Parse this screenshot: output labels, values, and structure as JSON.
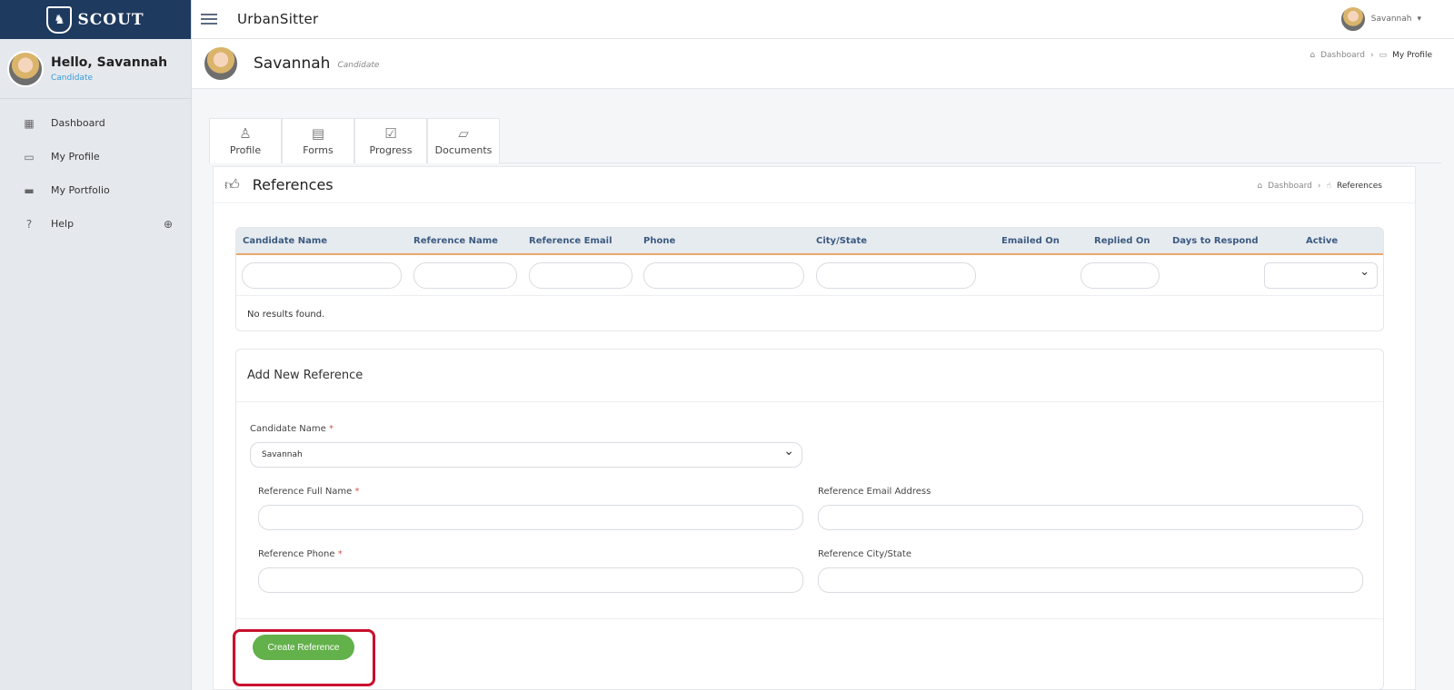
{
  "sidebar": {
    "brand": "SCOUT",
    "greeting": "Hello, Savannah",
    "role": "Candidate",
    "items": [
      {
        "label": "Dashboard"
      },
      {
        "label": "My Profile"
      },
      {
        "label": "My Portfolio"
      },
      {
        "label": "Help"
      }
    ]
  },
  "topbar": {
    "title": "UrbanSitter",
    "user": "Savannah"
  },
  "profile": {
    "name": "Savannah",
    "role": "Candidate",
    "breadcrumb": [
      "Dashboard",
      "My Profile"
    ]
  },
  "tabs": [
    {
      "label": "Profile"
    },
    {
      "label": "Forms"
    },
    {
      "label": "Progress"
    },
    {
      "label": "Documents"
    }
  ],
  "references": {
    "title": "References",
    "breadcrumb": [
      "Dashboard",
      "References"
    ],
    "columns": [
      "Candidate Name",
      "Reference Name",
      "Reference Email",
      "Phone",
      "City/State",
      "Emailed On",
      "Replied On",
      "Days to Respond",
      "Active"
    ],
    "empty_text": "No results found."
  },
  "form": {
    "title": "Add New Reference",
    "candidate_label": "Candidate Name",
    "candidate_value": "Savannah",
    "full_name_label": "Reference Full Name",
    "email_label": "Reference Email Address",
    "phone_label": "Reference Phone",
    "city_label": "Reference City/State",
    "required_mark": "*",
    "submit_label": "Create Reference"
  },
  "colors": {
    "brand": "#1f3a5f",
    "accent": "#62b14a",
    "header_underline": "#e9a86e",
    "highlight": "#c8102e"
  }
}
